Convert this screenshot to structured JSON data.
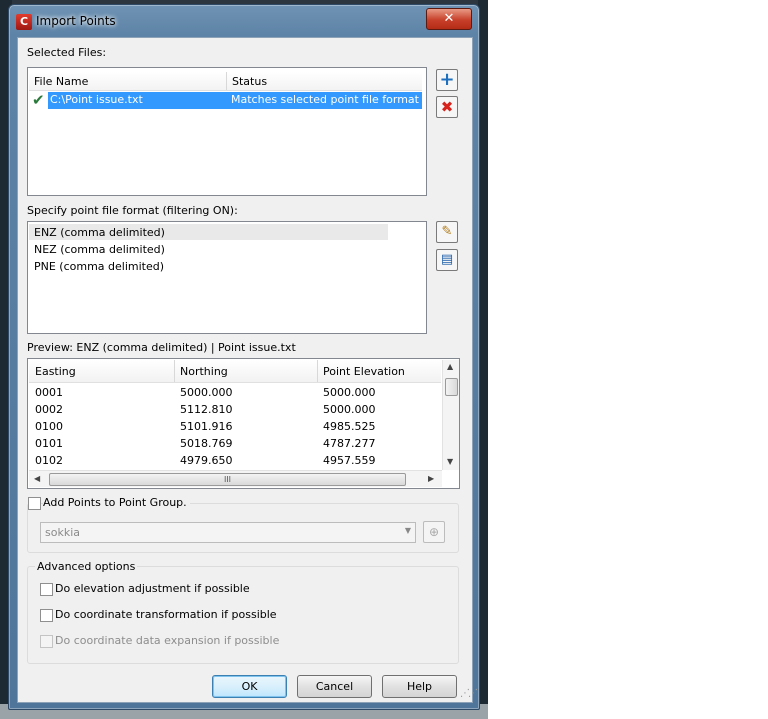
{
  "window": {
    "title": "Import Points",
    "close_glyph": "✕"
  },
  "selected_files": {
    "label": "Selected Files:",
    "columns": [
      "File Name",
      "Status"
    ],
    "rows": [
      {
        "file": "C:\\Point issue.txt",
        "status": "Matches selected point file format"
      }
    ]
  },
  "format": {
    "label": "Specify point file format (filtering ON):",
    "items": [
      "ENZ (comma delimited)",
      "NEZ (comma delimited)",
      "PNE (comma delimited)"
    ],
    "selected_index": 0
  },
  "preview": {
    "label": "Preview: ENZ (comma delimited) | Point issue.txt",
    "columns": [
      "Easting",
      "Northing",
      "Point Elevation"
    ],
    "rows": [
      [
        "0001",
        "5000.000",
        "5000.000"
      ],
      [
        "0002",
        "5112.810",
        "5000.000"
      ],
      [
        "0100",
        "5101.916",
        "4985.525"
      ],
      [
        "0101",
        "5018.769",
        "4787.277"
      ],
      [
        "0102",
        "4979.650",
        "4957.559"
      ]
    ]
  },
  "point_group": {
    "checkbox_label": "Add Points to Point Group.",
    "checked": false,
    "combo_value": "sokkia"
  },
  "advanced": {
    "legend": "Advanced options",
    "options": [
      {
        "label": "Do elevation adjustment if possible",
        "checked": false,
        "enabled": true
      },
      {
        "label": "Do coordinate transformation if possible",
        "checked": false,
        "enabled": true
      },
      {
        "label": "Do coordinate data expansion if possible",
        "checked": false,
        "enabled": false
      }
    ]
  },
  "buttons": {
    "ok": "OK",
    "cancel": "Cancel",
    "help": "Help"
  },
  "scroll_thumb_grip": "III"
}
